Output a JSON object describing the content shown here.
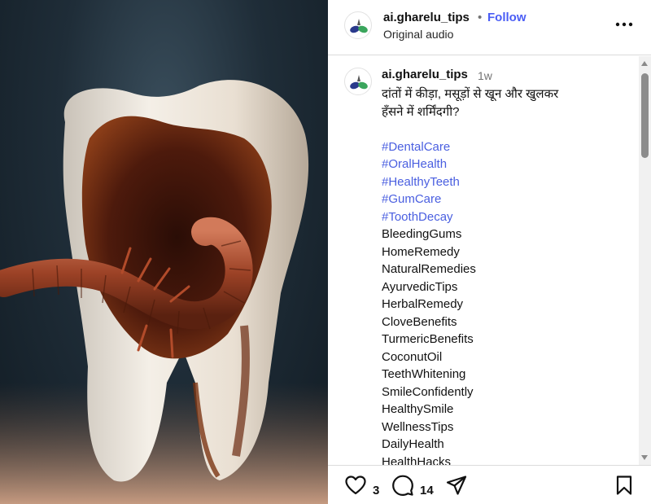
{
  "post": {
    "username": "ai.gharelu_tips",
    "separator": "•",
    "follow_label": "Follow",
    "audio_label": "Original audio"
  },
  "caption": {
    "username": "ai.gharelu_tips",
    "time": "1w",
    "lines": [
      "दांतों में कीड़ा, मसूड़ों से खून और खुलकर",
      "हँसने में शर्मिंदगी?"
    ],
    "hashtags": [
      "#DentalCare",
      "#OralHealth",
      "#HealthyTeeth",
      "#GumCare",
      "#ToothDecay"
    ],
    "keywords": [
      "BleedingGums",
      "HomeRemedy",
      "NaturalRemedies",
      "AyurvedicTips",
      "HerbalRemedy",
      "CloveBenefits",
      "TurmericBenefits",
      "CoconutOil",
      "TeethWhitening",
      "SmileConfidently",
      "HealthySmile",
      "WellnessTips",
      "DailyHealth",
      "HealthHacks"
    ]
  },
  "actions": {
    "like_count": "3",
    "comment_count": "14"
  },
  "icons": {
    "avatar": "pills-logo-icon",
    "more": "more-horizontal-icon",
    "like": "heart-icon",
    "comment": "comment-bubble-icon",
    "share": "paper-plane-icon",
    "save": "bookmark-icon"
  },
  "colors": {
    "follow": "#4a5df5",
    "hashtag": "#4a5fe0",
    "secondary_text": "#737373"
  }
}
